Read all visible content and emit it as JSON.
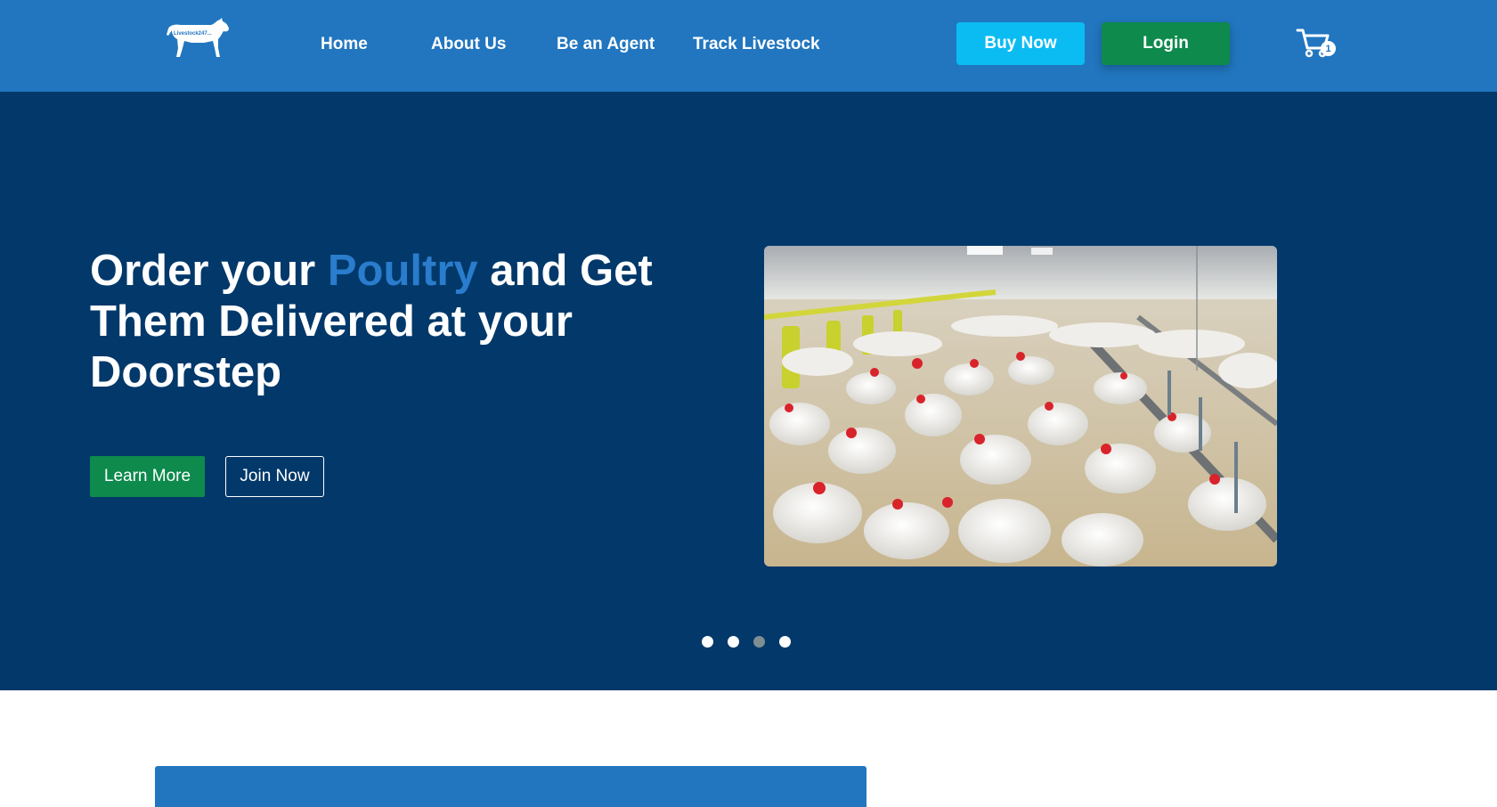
{
  "brand": {
    "logo_text": "Livestock247...",
    "logo_icon": "cow-logo-icon"
  },
  "nav": {
    "links": [
      "Home",
      "About Us",
      "Be an Agent",
      "Track Livestock"
    ],
    "buy_label": "Buy Now",
    "login_label": "Login",
    "cart_icon": "cart-icon",
    "cart_count": "1"
  },
  "hero": {
    "title_part1": "Order your ",
    "title_accent": "Poultry",
    "title_part2": " and Get Them Delivered at your Doorstep",
    "learn_more_label": "Learn More",
    "join_now_label": "Join Now",
    "image_subject": "poultry-farm-chickens",
    "carousel": {
      "slide_count": 4,
      "active_index": 2
    }
  },
  "colors": {
    "nav_bg": "#2176bf",
    "hero_bg": "#02386a",
    "accent_text": "#2a7ccc",
    "buy_button": "#0bbcf2",
    "green_button": "#0d8a4c",
    "dot_active": "#7e8e92"
  }
}
